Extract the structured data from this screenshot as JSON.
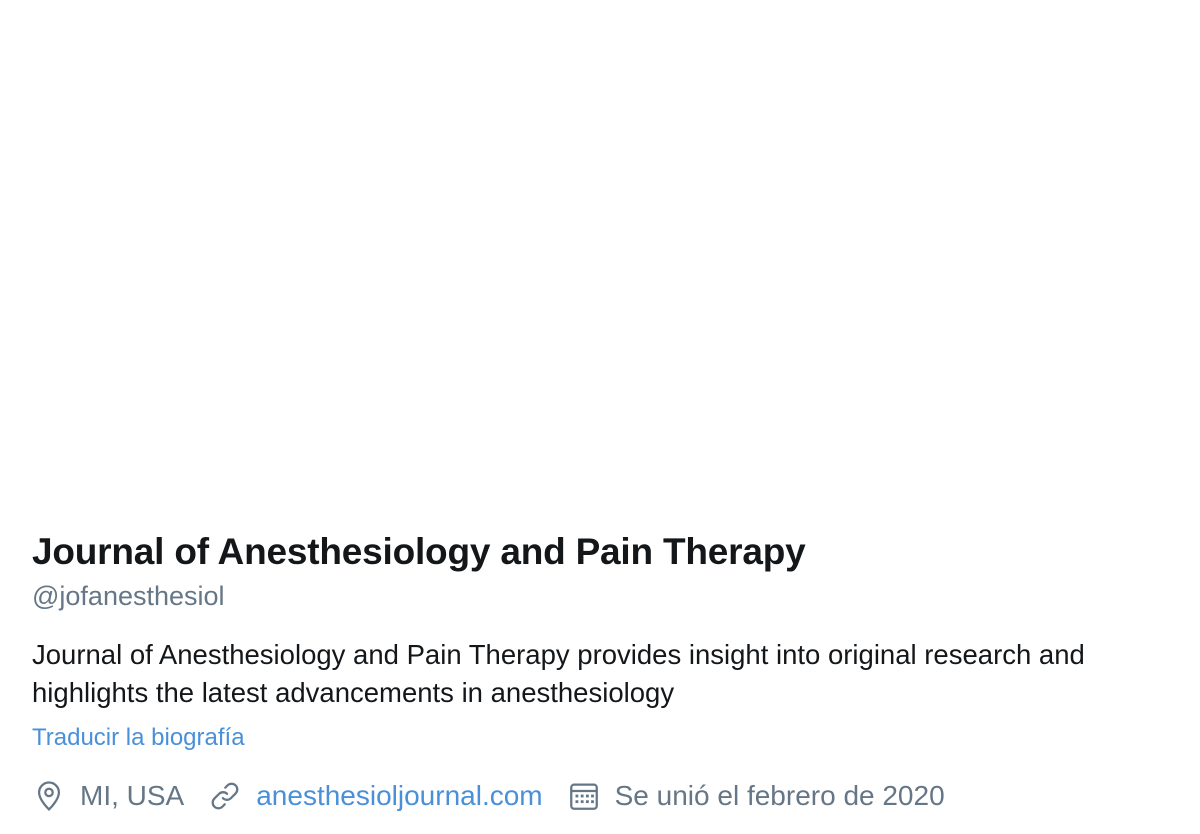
{
  "profile": {
    "display_name": "Journal of Anesthesiology and Pain Therapy",
    "handle": "@jofanesthesiol",
    "bio": "Journal of Anesthesiology and Pain Therapy provides insight into original research and highlights the latest advancements in anesthesiology",
    "translate_label": "Traducir la biografía",
    "location": "MI, USA",
    "website": "anesthesioljournal.com",
    "joined": "Se unió el febrero de 2020"
  },
  "icons": {
    "location": "location-pin-icon",
    "website": "link-icon",
    "joined": "calendar-icon"
  },
  "colors": {
    "text_primary": "#14171a",
    "text_secondary": "#657786",
    "link": "#4a90d9"
  }
}
